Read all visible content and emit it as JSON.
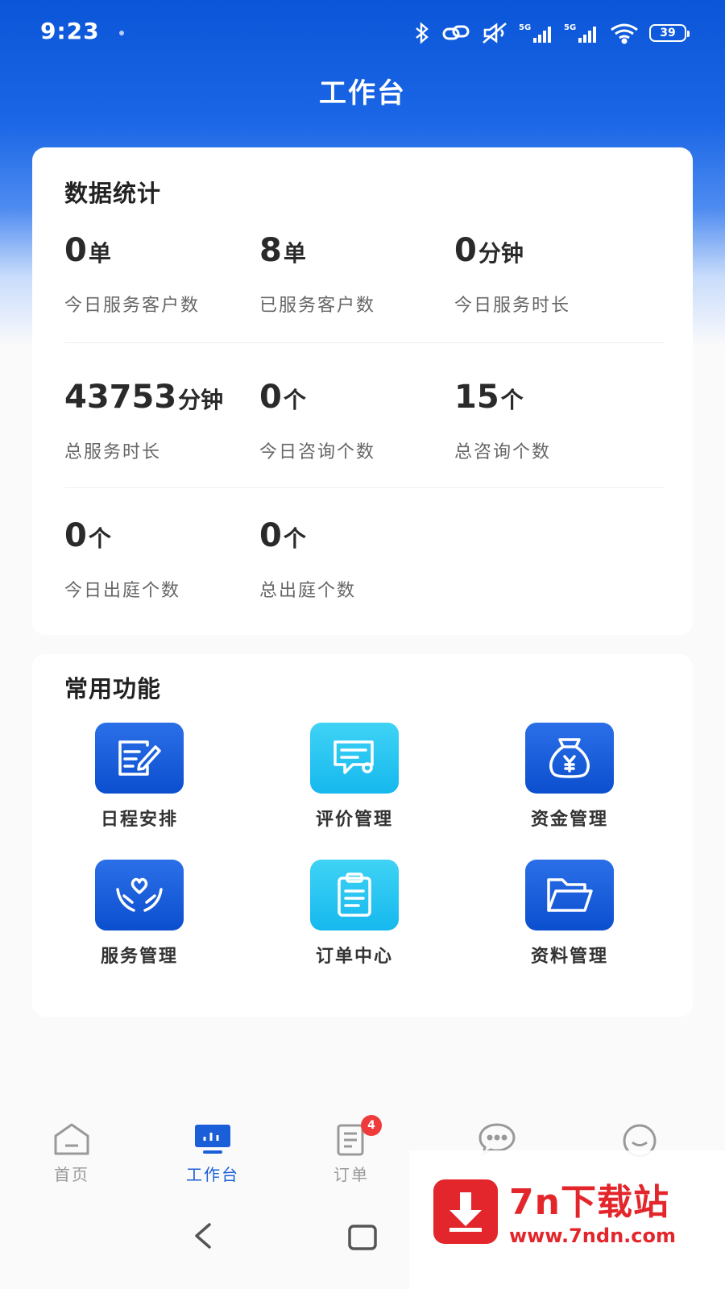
{
  "status_bar": {
    "time": "9:23",
    "battery": "39",
    "icons": [
      "bluetooth-icon",
      "link-icon",
      "mute-icon",
      "signal-5g-icon",
      "signal-5g-icon",
      "wifi-icon",
      "battery-icon"
    ]
  },
  "header": {
    "title": "工作台"
  },
  "stats": {
    "title": "数据统计",
    "items": [
      {
        "value": "0",
        "unit": "单",
        "label": "今日服务客户数"
      },
      {
        "value": "8",
        "unit": "单",
        "label": "已服务客户数"
      },
      {
        "value": "0",
        "unit": "分钟",
        "label": "今日服务时长"
      },
      {
        "value": "43753",
        "unit": "分钟",
        "label": "总服务时长"
      },
      {
        "value": "0",
        "unit": "个",
        "label": "今日咨询个数"
      },
      {
        "value": "15",
        "unit": "个",
        "label": "总咨询个数"
      },
      {
        "value": "0",
        "unit": "个",
        "label": "今日出庭个数"
      },
      {
        "value": "0",
        "unit": "个",
        "label": "总出庭个数"
      }
    ]
  },
  "functions": {
    "title": "常用功能",
    "items": [
      {
        "label": "日程安排",
        "icon": "schedule-icon",
        "color": "#0b4fcf"
      },
      {
        "label": "评价管理",
        "icon": "review-icon",
        "color": "#16b8ee"
      },
      {
        "label": "资金管理",
        "icon": "money-bag-icon",
        "color": "#0b4fcf"
      },
      {
        "label": "服务管理",
        "icon": "service-hands-icon",
        "color": "#0b4fcf"
      },
      {
        "label": "订单中心",
        "icon": "clipboard-icon",
        "color": "#16b8ee"
      },
      {
        "label": "资料管理",
        "icon": "folder-icon",
        "color": "#0b4fcf"
      }
    ]
  },
  "tab_bar": {
    "items": [
      {
        "label": "首页",
        "icon": "home-icon",
        "active": false
      },
      {
        "label": "工作台",
        "icon": "workbench-icon",
        "active": true
      },
      {
        "label": "订单",
        "icon": "order-icon",
        "active": false,
        "badge": "4"
      },
      {
        "label": "",
        "icon": "message-icon",
        "active": false
      },
      {
        "label": "",
        "icon": "profile-icon",
        "active": false
      }
    ]
  },
  "watermark": {
    "name": "7n下载站",
    "url": "www.7ndn.com"
  },
  "colors": {
    "primary": "#1a5fd8",
    "accent": "#16b8ee",
    "badge": "#ef3b3b",
    "watermark": "#e3262b"
  }
}
